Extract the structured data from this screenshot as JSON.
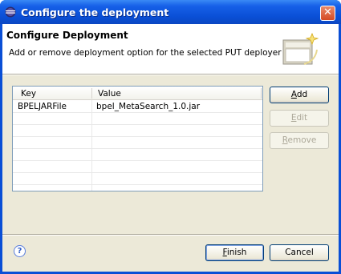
{
  "window": {
    "title": "Configure the deployment",
    "close_glyph": "✕"
  },
  "header": {
    "title": "Configure Deployment",
    "message": "Add or remove deployment option for the selected PUT deployer"
  },
  "table": {
    "columns": [
      "Key",
      "Value"
    ],
    "rows": [
      {
        "key": "BPELJARFile",
        "value": "bpel_MetaSearch_1.0.jar"
      }
    ]
  },
  "buttons": {
    "add": {
      "underline": "A",
      "rest": "dd"
    },
    "edit": {
      "underline": "E",
      "rest": "dit"
    },
    "remove": {
      "underline": "R",
      "rest": "emove"
    },
    "finish": {
      "underline": "F",
      "rest": "inish"
    },
    "cancel": "Cancel"
  },
  "help": {
    "glyph": "?"
  },
  "icons": {
    "title": "eclipse-icon",
    "banner": "wizard-banner-icon",
    "help": "help-icon",
    "close": "close-icon"
  }
}
